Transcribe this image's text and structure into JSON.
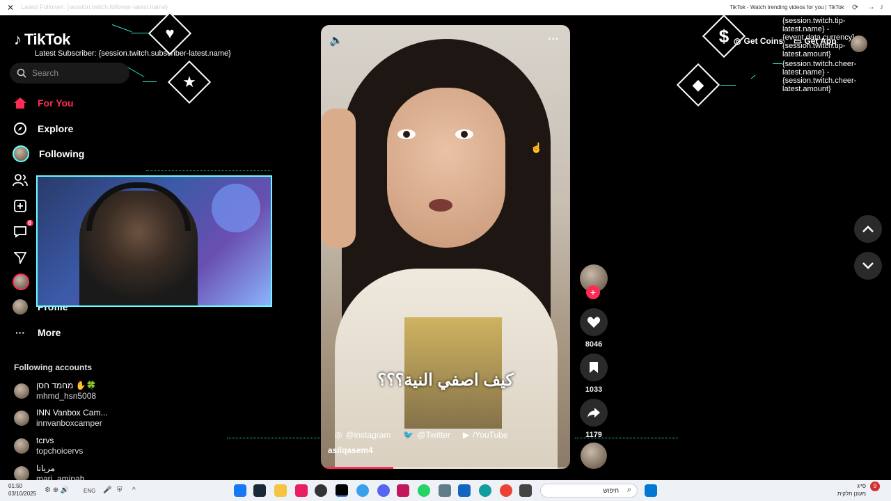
{
  "browser": {
    "url": "Latest Follower: {session.twitch.follower-latest.name}",
    "tab_title": "TikTok - Watch trending videos for you | TikTok"
  },
  "brand": {
    "name": "TikTok"
  },
  "overlay": {
    "latest_subscriber": "Latest Subscriber: {session.twitch.subscriber-latest.name}",
    "tip_lines": "{session.twitch.tip-latest.name} - {event.data.currency}{session.twitch.tip-latest.amount}",
    "cheer_lines": "{session.twitch.cheer-latest.name} - {session.twitch.cheer-latest.amount}",
    "accent_color": "#33e0c8"
  },
  "search": {
    "placeholder": "Search"
  },
  "nav": {
    "for_you": "For You",
    "explore": "Explore",
    "following": "Following",
    "messages_badge": "8",
    "profile": "Profile",
    "more": "More"
  },
  "following_accounts": {
    "title": "Following accounts",
    "items": [
      {
        "display": "מחמד חסן ✋🍀",
        "username": "mhmd_hsn5008"
      },
      {
        "display": "INN Vanbox Cam...",
        "username": "innvanboxcamper"
      },
      {
        "display": "tcrvs",
        "username": "topchoicervs"
      },
      {
        "display": "مريانا",
        "username": "mari_aminah"
      }
    ]
  },
  "video": {
    "caption": "كيف اصفي النية؟؟؟",
    "socials": [
      "@instagram",
      "@Twitter",
      "/YouTube"
    ],
    "author": "asilqasem4",
    "progress": 0.29
  },
  "actions": {
    "likes": "8046",
    "saves": "1033",
    "shares": "1179"
  },
  "header": {
    "get_coins": "Get Coins",
    "get_app": "Get App"
  },
  "taskbar": {
    "time": "01:50",
    "date": "03/10/2025",
    "lang": "ENG",
    "search_label": "חיפוש",
    "notif_line1": "סייג",
    "notif_line2": "מעונן חלקית",
    "notif_count": "9"
  },
  "colors": {
    "brand_red": "#fe2c55",
    "background": "#000000"
  }
}
